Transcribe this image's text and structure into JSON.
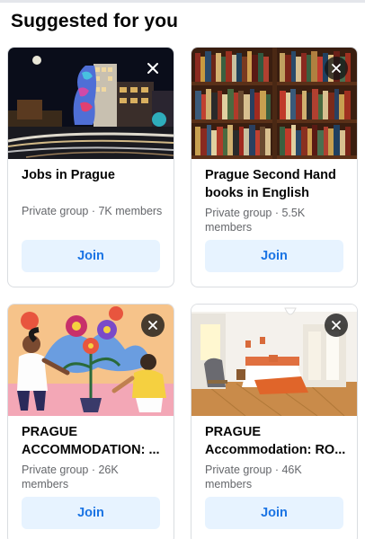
{
  "section": {
    "title": "Suggested for you"
  },
  "cards": [
    {
      "title": "Jobs in Prague",
      "meta": "Private group · 7K members",
      "join_label": "Join",
      "image": "night-city-dancing-house"
    },
    {
      "title": "Prague Second Hand books in English",
      "meta": "Private group · 5.5K members",
      "join_label": "Join",
      "image": "bookshelves"
    },
    {
      "title": "PRAGUE ACCOMMODATION: ...",
      "meta": "Private group · 26K members",
      "join_label": "Join",
      "image": "illustration-gardening"
    },
    {
      "title": "PRAGUE Accommodation: RO...",
      "meta": "Private group · 46K members",
      "join_label": "Join",
      "image": "apartment-room"
    }
  ],
  "icons": {
    "close": "close-icon"
  },
  "colors": {
    "join_bg": "#e7f3ff",
    "join_text": "#1b74e4",
    "meta_text": "#65676b"
  }
}
